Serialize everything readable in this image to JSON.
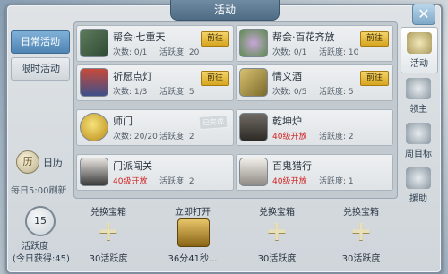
{
  "window": {
    "title": "活动",
    "close_label": "✕"
  },
  "left_nav": {
    "daily": "日常活动",
    "limited": "限时活动",
    "calendar_icon_text": "历",
    "calendar_label": "日历",
    "refresh_note": "每日5:00刷新"
  },
  "cards": [
    {
      "name": "帮会·七重天",
      "count": "次数: 0/1",
      "activity": "活跃度: 20",
      "action": "前往"
    },
    {
      "name": "帮会·百花齐放",
      "count": "次数: 0/1",
      "activity": "活跃度: 10",
      "action": "前往"
    },
    {
      "name": "祈愿点灯",
      "count": "次数: 1/3",
      "activity": "活跃度: 5",
      "action": "前往"
    },
    {
      "name": "情义酒",
      "count": "次数: 0/5",
      "activity": "活跃度: 5",
      "action": "前往"
    },
    {
      "name": "师门",
      "count": "次数: 20/20",
      "activity": "活跃度: 2",
      "stamp": "已完成"
    },
    {
      "name": "乾坤炉",
      "requirement": "40级开放",
      "activity": "活跃度: 2"
    },
    {
      "name": "门派闯关",
      "requirement": "40级开放",
      "activity": "活跃度: 2"
    },
    {
      "name": "百鬼猎行",
      "requirement": "40级开放",
      "activity": "活跃度: 1"
    }
  ],
  "right_tabs": [
    "活动",
    "领主",
    "周目标",
    "援助"
  ],
  "bottom": {
    "activity_value": "15",
    "activity_label": "活跃度",
    "activity_today": "(今日获得:45)",
    "chests": [
      {
        "title": "兑换宝箱",
        "caption": "30活跃度",
        "icon": "plus-icon"
      },
      {
        "title": "立即打开",
        "caption": "36分41秒...",
        "icon": "treasure-chest-icon"
      },
      {
        "title": "兑换宝箱",
        "caption": "30活跃度",
        "icon": "plus-icon"
      },
      {
        "title": "兑换宝箱",
        "caption": "30活跃度",
        "icon": "plus-icon"
      }
    ]
  },
  "colors": {
    "accent_blue": "#4f84b2",
    "button_gold": "#d7a51f",
    "locked_red": "#d02323"
  }
}
